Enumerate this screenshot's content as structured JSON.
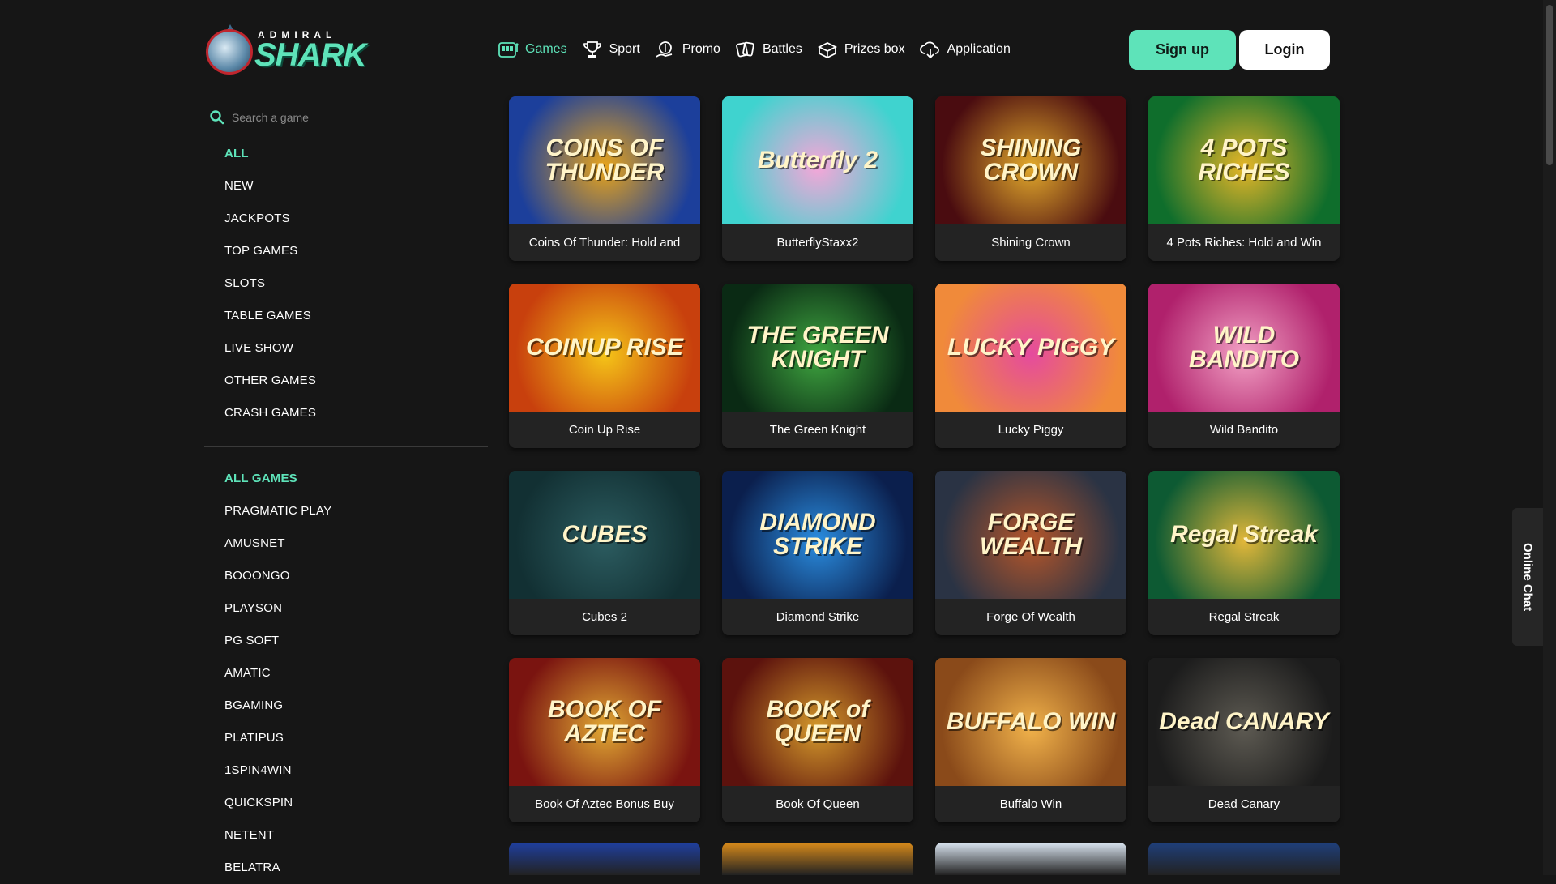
{
  "logo": {
    "top_word": "ADMIRAL",
    "main_word": "SHARK"
  },
  "nav": [
    {
      "label": "Games",
      "icon": "slot-machine-icon",
      "active": true
    },
    {
      "label": "Sport",
      "icon": "trophy-icon",
      "active": false
    },
    {
      "label": "Promo",
      "icon": "gift-hand-icon",
      "active": false
    },
    {
      "label": "Battles",
      "icon": "battle-cards-icon",
      "active": false
    },
    {
      "label": "Prizes box",
      "icon": "prize-box-icon",
      "active": false
    },
    {
      "label": "Application",
      "icon": "cloud-download-icon",
      "active": false
    }
  ],
  "auth": {
    "signup": "Sign up",
    "login": "Login"
  },
  "search": {
    "placeholder": "Search a game",
    "value": ""
  },
  "categories": [
    {
      "label": "ALL",
      "active": true
    },
    {
      "label": "NEW"
    },
    {
      "label": "JACKPOTS"
    },
    {
      "label": "TOP GAMES"
    },
    {
      "label": "SLOTS"
    },
    {
      "label": "TABLE GAMES"
    },
    {
      "label": "LIVE SHOW"
    },
    {
      "label": "OTHER GAMES"
    },
    {
      "label": "CRASH GAMES"
    }
  ],
  "providers": [
    {
      "label": "ALL GAMES",
      "active": true
    },
    {
      "label": "PRAGMATIC PLAY"
    },
    {
      "label": "AMUSNET"
    },
    {
      "label": "BOOONGO"
    },
    {
      "label": "PLAYSON"
    },
    {
      "label": "PG SOFT"
    },
    {
      "label": "AMATIC"
    },
    {
      "label": "BGAMING"
    },
    {
      "label": "PLATIPUS"
    },
    {
      "label": "1SPIN4WIN"
    },
    {
      "label": "QUICKSPIN"
    },
    {
      "label": "NETENT"
    },
    {
      "label": "BELATRA"
    }
  ],
  "games": [
    {
      "name": "Coins Of Thunder: Hold and",
      "art": "COINS OF THUNDER",
      "colors": [
        "#1c3f9b",
        "#e9a51b"
      ]
    },
    {
      "name": "ButterflyStaxx2",
      "art": "Butterfly 2",
      "colors": [
        "#3fd3cf",
        "#f6a6d8"
      ]
    },
    {
      "name": "Shining Crown",
      "art": "SHINING CROWN",
      "colors": [
        "#4a0c10",
        "#e3aa2c"
      ]
    },
    {
      "name": "4 Pots Riches: Hold and Win",
      "art": "4 POTS RICHES",
      "colors": [
        "#0f6e2c",
        "#e6b628"
      ]
    },
    {
      "name": "Coin Up Rise",
      "art": "COINUP RISE",
      "colors": [
        "#c8400d",
        "#f5c518"
      ]
    },
    {
      "name": "The Green Knight",
      "art": "THE GREEN KNIGHT",
      "colors": [
        "#0a2a14",
        "#3fa640"
      ]
    },
    {
      "name": "Lucky Piggy",
      "art": "LUCKY PIGGY",
      "colors": [
        "#f08a3a",
        "#e54b9e"
      ]
    },
    {
      "name": "Wild Bandito",
      "art": "WILD BANDITO",
      "colors": [
        "#b0216c",
        "#f2a0c4"
      ]
    },
    {
      "name": "Cubes 2",
      "art": "CUBES",
      "colors": [
        "#123033",
        "#2c5c60"
      ]
    },
    {
      "name": "Diamond Strike",
      "art": "DIAMOND STRIKE",
      "colors": [
        "#0b1f4d",
        "#2a8de0"
      ]
    },
    {
      "name": "Forge Of Wealth",
      "art": "FORGE WEALTH",
      "colors": [
        "#2a3344",
        "#b5562a"
      ]
    },
    {
      "name": "Regal Streak",
      "art": "Regal Streak",
      "colors": [
        "#0d5a33",
        "#e1b73a"
      ]
    },
    {
      "name": "Book Of Aztec Bonus Buy",
      "art": "BOOK OF AZTEC",
      "colors": [
        "#7a1410",
        "#e1a833"
      ]
    },
    {
      "name": "Book Of Queen",
      "art": "BOOK of QUEEN",
      "colors": [
        "#5c120d",
        "#d4992b"
      ]
    },
    {
      "name": "Buffalo Win",
      "art": "BUFFALO WIN",
      "colors": [
        "#8a4a1a",
        "#f1b24a"
      ]
    },
    {
      "name": "Dead Canary",
      "art": "Dead CANARY",
      "colors": [
        "#1c1c1c",
        "#5d5a52"
      ]
    }
  ],
  "partial_row_colors": [
    "#1f3f9e",
    "#d88a1a",
    "#d9e4f0",
    "#1f3f7a"
  ],
  "chat": {
    "label": "Online Chat"
  },
  "accent": "#5ee3b9"
}
